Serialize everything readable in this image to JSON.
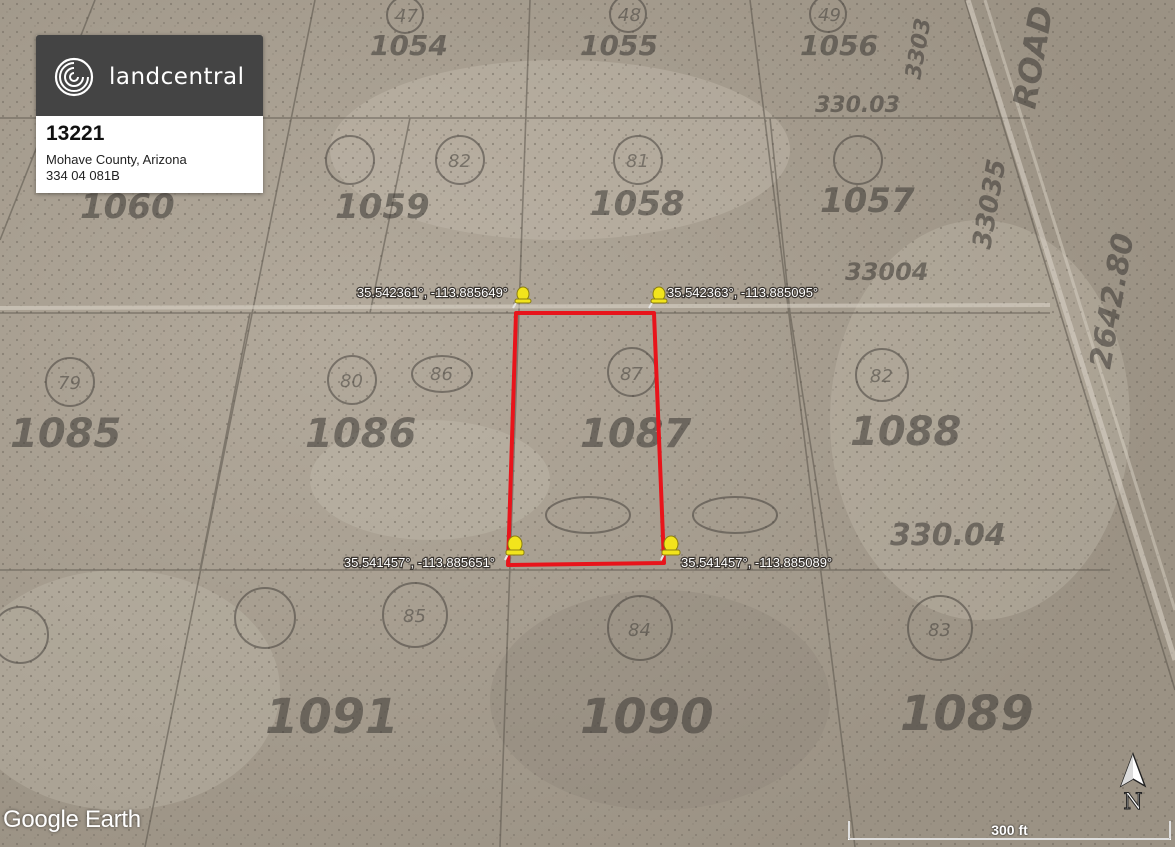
{
  "card": {
    "logo_text": "landcentral",
    "title": "13221",
    "location": "Mohave County, Arizona",
    "parcel": "334 04 081B"
  },
  "pins": [
    {
      "label": "35.542361°, -113.885649°"
    },
    {
      "label": "35.542363°, -113.885095°"
    },
    {
      "label": "35.541457°, -113.885651°"
    },
    {
      "label": "35.541457°, -113.885089°"
    }
  ],
  "plat": {
    "lots": [
      "1054",
      "1055",
      "1056",
      "1060",
      "1059",
      "1058",
      "1057",
      "1085",
      "1086",
      "1087",
      "1088",
      "1091",
      "1090",
      "1089"
    ],
    "circles": [
      "47",
      "48",
      "49",
      "82",
      "81",
      "79",
      "80",
      "86",
      "87",
      "82",
      "84",
      "83",
      "85"
    ],
    "misc": [
      "330.03",
      "33004",
      "330.04",
      "3303",
      "33035",
      "2642.80",
      "ROAD"
    ]
  },
  "boundary_color": "#e8141b",
  "pin_color": "#f2e41c",
  "attribution": "Google Earth",
  "compass_label": "N",
  "scale_label": "300 ft"
}
